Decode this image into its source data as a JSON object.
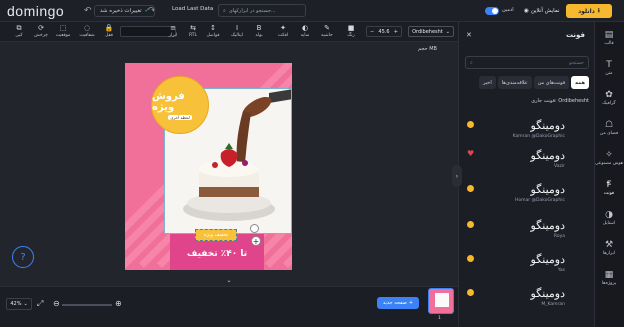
{
  "header": {
    "logo": "domingo",
    "saved_label": "تغییرات ذخیره شد",
    "load_last_data": "Load Last Data",
    "search_placeholder": "جستجو در ابزارکهای...",
    "admin_toggle_label": "ادمین",
    "preview_label": "نمایش آنلاین",
    "download_label": "دانلود"
  },
  "toolbar": {
    "font_name": "Ordibehesht",
    "font_size": "45.6",
    "tools": [
      {
        "icon": "rect",
        "label": "رنگ"
      },
      {
        "icon": "pen",
        "label": "حاشیه"
      },
      {
        "icon": "shadow",
        "label": "سایه"
      },
      {
        "icon": "effect",
        "label": "افکت"
      },
      {
        "icon": "B",
        "label": "بولد"
      },
      {
        "icon": "I",
        "label": "ایتالیک"
      },
      {
        "icon": "spacing",
        "label": "فواصل"
      },
      {
        "icon": "RTL",
        "label": "RTL"
      },
      {
        "icon": "align",
        "label": "ابزار"
      },
      {
        "icon": "lock",
        "label": "قفل"
      },
      {
        "icon": "opacity",
        "label": "شفافیت"
      },
      {
        "icon": "position",
        "label": "موقعیت"
      },
      {
        "icon": "rotate",
        "label": "چرخش"
      },
      {
        "icon": "copy",
        "label": "کپی"
      }
    ]
  },
  "canvas": {
    "size_label": "حجم MB",
    "circle_title": "فروش ویژه",
    "circle_sub": "لحظه آخری",
    "tag_text": "تخفیف ویژه",
    "discount_text": "تا ۴۰٪ تخفیف"
  },
  "bottom": {
    "zoom_value": "42%",
    "new_page_label": "صفحه جدید",
    "page_number": "1"
  },
  "panel": {
    "title": "فونت",
    "search_placeholder": "جستجو",
    "filters": [
      "همه",
      "فونت‌های من",
      "علاقه‌مندی‌ها",
      "اخیر"
    ],
    "current_font_label": "فونت جاری: Ordibehesht",
    "fonts": [
      {
        "name": "دومینگو",
        "author": "Kamran @DakoGraphic",
        "mark": "star"
      },
      {
        "name": "دومینگو",
        "author": "Vazir",
        "mark": "heart"
      },
      {
        "name": "دومینگو",
        "author": "Homar @DakoGraphic",
        "mark": "star"
      },
      {
        "name": "دومینگو",
        "author": "Roya",
        "mark": "star"
      },
      {
        "name": "دومینگو",
        "author": "Yas",
        "mark": "star"
      },
      {
        "name": "دومینگو",
        "author": "M_Kamran",
        "mark": "star"
      }
    ]
  },
  "nav": [
    {
      "icon": "template",
      "label": "قالب"
    },
    {
      "icon": "text",
      "label": "متن"
    },
    {
      "icon": "graphic",
      "label": "گرافیک"
    },
    {
      "icon": "mine",
      "label": "فضای من"
    },
    {
      "icon": "ai",
      "label": "هوش مصنوعی"
    },
    {
      "icon": "font",
      "label": "فونت"
    },
    {
      "icon": "style",
      "label": "استایل"
    },
    {
      "icon": "tools",
      "label": "ابزارها"
    },
    {
      "icon": "gallery",
      "label": "پروژه‌ها"
    }
  ]
}
